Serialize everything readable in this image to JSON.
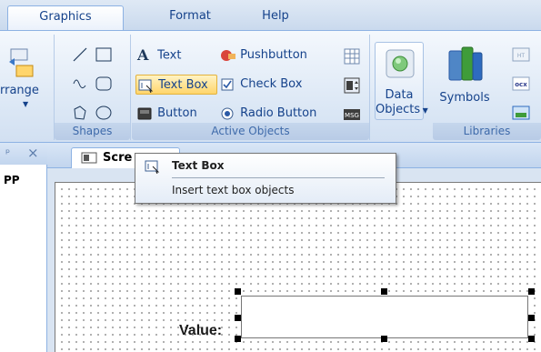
{
  "ribbon_tabs": [
    {
      "label": "Graphics",
      "active": true
    },
    {
      "label": "Format",
      "active": false
    },
    {
      "label": "Help",
      "active": false
    }
  ],
  "groups": {
    "arrange": {
      "label": "rrange"
    },
    "shapes": {
      "label": "Shapes"
    },
    "active_objects": {
      "label": "Active Objects",
      "buttons": {
        "text": "Text",
        "pushbutton": "Pushbutton",
        "text_box": "Text Box",
        "check_box": "Check Box",
        "button": "Button",
        "radio_button": "Radio Button"
      }
    },
    "data_objects": {
      "label_line1": "Data",
      "label_line2": "Objects"
    },
    "libraries": {
      "label": "Libraries",
      "symbols": "Symbols"
    }
  },
  "left_pane": {
    "close_glyph": "×",
    "pin_glyph": "ᵖ",
    "text": "PP"
  },
  "document_tab": {
    "label": "Scre"
  },
  "tooltip": {
    "title": "Text Box",
    "description": "Insert text box objects"
  },
  "canvas": {
    "value_label": "Value:"
  },
  "colors": {
    "accent": "#15428b",
    "selection": "#ffd56b",
    "ribbon_border": "#8db2e3"
  },
  "icons": {
    "text": "text-A-icon",
    "pushbutton": "pushbutton-icon",
    "text_box": "text-box-icon",
    "check_box": "check-box-icon",
    "button": "button-icon",
    "radio_button": "radio-button-icon",
    "data_objects": "data-objects-icon",
    "symbols": "symbols-books-icon"
  }
}
